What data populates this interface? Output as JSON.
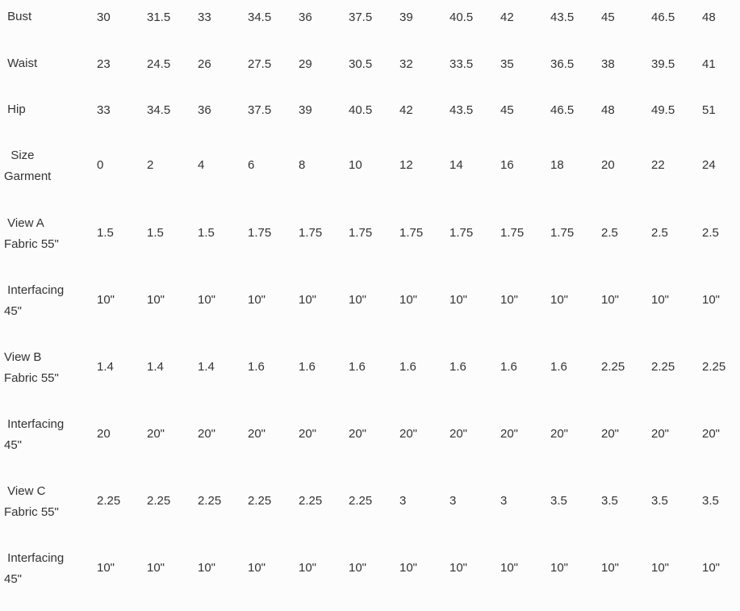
{
  "size_chart": {
    "sizes": [
      "0",
      "2",
      "4",
      "6",
      "8",
      "10",
      "12",
      "14",
      "16",
      "18",
      "20",
      "22",
      "24"
    ],
    "rows": [
      {
        "label": " Bust",
        "values": [
          "30",
          "31.5",
          "33",
          "34.5",
          "36",
          "37.5",
          "39",
          "40.5",
          "42",
          "43.5",
          "45",
          "46.5",
          "48"
        ]
      },
      {
        "label": " Waist",
        "values": [
          "23",
          "24.5",
          "26",
          "27.5",
          "29",
          "30.5",
          "32",
          "33.5",
          "35",
          "36.5",
          "38",
          "39.5",
          "41"
        ]
      },
      {
        "label": " Hip",
        "values": [
          "33",
          "34.5",
          "36",
          "37.5",
          "39",
          "40.5",
          "42",
          "43.5",
          "45",
          "46.5",
          "48",
          "49.5",
          "51"
        ]
      },
      {
        "label": "  Size\nGarment",
        "values": [
          "0",
          "2",
          "4",
          "6",
          "8",
          "10",
          "12",
          "14",
          "16",
          "18",
          "20",
          "22",
          "24"
        ]
      },
      {
        "label": " View A\nFabric 55\"",
        "values": [
          "1.5",
          "1.5",
          "1.5",
          "1.75",
          "1.75",
          "1.75",
          "1.75",
          "1.75",
          "1.75",
          "1.75",
          "2.5",
          "2.5",
          "2.5"
        ]
      },
      {
        "label": " Interfacing\n45\"",
        "values": [
          "10\"",
          "10\"",
          "10\"",
          "10\"",
          "10\"",
          "10\"",
          "10\"",
          "10\"",
          "10\"",
          "10\"",
          "10\"",
          "10\"",
          "10\""
        ]
      },
      {
        "label": "View B\nFabric 55\"",
        "values": [
          "1.4",
          "1.4",
          "1.4",
          "1.6",
          "1.6",
          "1.6",
          "1.6",
          "1.6",
          "1.6",
          "1.6",
          "2.25",
          "2.25",
          "2.25"
        ]
      },
      {
        "label": " Interfacing\n45\"",
        "values": [
          "20",
          "20\"",
          "20\"",
          "20\"",
          "20\"",
          "20\"",
          "20\"",
          "20\"",
          "20\"",
          "20\"",
          "20\"",
          "20\"",
          "20\""
        ]
      },
      {
        "label": " View C\nFabric 55\"",
        "values": [
          "2.25",
          "2.25",
          "2.25",
          "2.25",
          "2.25",
          "2.25",
          "3",
          "3",
          "3",
          "3.5",
          "3.5",
          "3.5",
          "3.5"
        ]
      },
      {
        "label": " Interfacing\n45\"",
        "values": [
          "10\"",
          "10\"",
          "10\"",
          "10\"",
          "10\"",
          "10\"",
          "10\"",
          "10\"",
          "10\"",
          "10\"",
          "10\"",
          "10\"",
          "10\""
        ]
      }
    ]
  }
}
